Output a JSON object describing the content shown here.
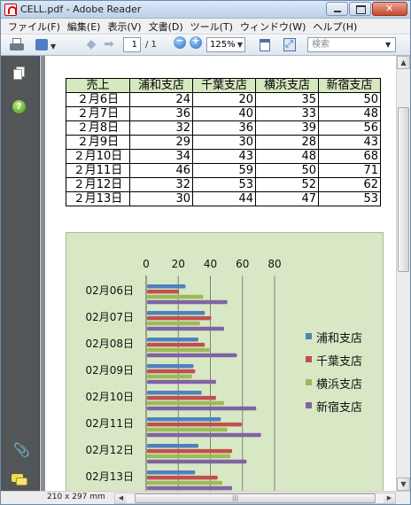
{
  "window": {
    "title": "CELL.pdf - Adobe Reader"
  },
  "menu": [
    "ファイル(F)",
    "編集(E)",
    "表示(V)",
    "文書(D)",
    "ツール(T)",
    "ウィンドウ(W)",
    "ヘルプ(H)"
  ],
  "toolbar": {
    "current_page": "1",
    "page_total": "/ 1",
    "zoom": "125%",
    "search_placeholder": "検索"
  },
  "status": {
    "page_size": "210 x 297 mm"
  },
  "table": {
    "headers": [
      "売上",
      "浦和支店",
      "千葉支店",
      "横浜支店",
      "新宿支店"
    ],
    "rows": [
      {
        "label": "２月6日",
        "values": [
          "24",
          "20",
          "35",
          "50"
        ]
      },
      {
        "label": "２月7日",
        "values": [
          "36",
          "40",
          "33",
          "48"
        ]
      },
      {
        "label": "２月8日",
        "values": [
          "32",
          "36",
          "39",
          "56"
        ]
      },
      {
        "label": "２月9日",
        "values": [
          "29",
          "30",
          "28",
          "43"
        ]
      },
      {
        "label": "２月10日",
        "values": [
          "34",
          "43",
          "48",
          "68"
        ]
      },
      {
        "label": "２月11日",
        "values": [
          "46",
          "59",
          "50",
          "71"
        ]
      },
      {
        "label": "２月12日",
        "values": [
          "32",
          "53",
          "52",
          "62"
        ]
      },
      {
        "label": "２月13日",
        "values": [
          "30",
          "44",
          "47",
          "53"
        ]
      }
    ]
  },
  "chart_data": {
    "type": "bar",
    "orientation": "horizontal",
    "categories": [
      "02月06日",
      "02月07日",
      "02月08日",
      "02月09日",
      "02月10日",
      "02月11日",
      "02月12日",
      "02月13日"
    ],
    "series": [
      {
        "name": "浦和支店",
        "color": "#4f81bd",
        "values": [
          24,
          36,
          32,
          29,
          34,
          46,
          32,
          30
        ]
      },
      {
        "name": "千葉支店",
        "color": "#c0504d",
        "values": [
          20,
          40,
          36,
          30,
          43,
          59,
          53,
          44
        ]
      },
      {
        "name": "横浜支店",
        "color": "#9bbb59",
        "values": [
          35,
          33,
          39,
          28,
          48,
          50,
          52,
          47
        ]
      },
      {
        "name": "新宿支店",
        "color": "#8064a2",
        "values": [
          50,
          48,
          56,
          43,
          68,
          71,
          62,
          53
        ]
      }
    ],
    "x_ticks": [
      "0",
      "20",
      "40",
      "60",
      "80"
    ],
    "xlim": [
      0,
      80
    ],
    "axis_position": "top",
    "legend": "right",
    "grid": true
  }
}
